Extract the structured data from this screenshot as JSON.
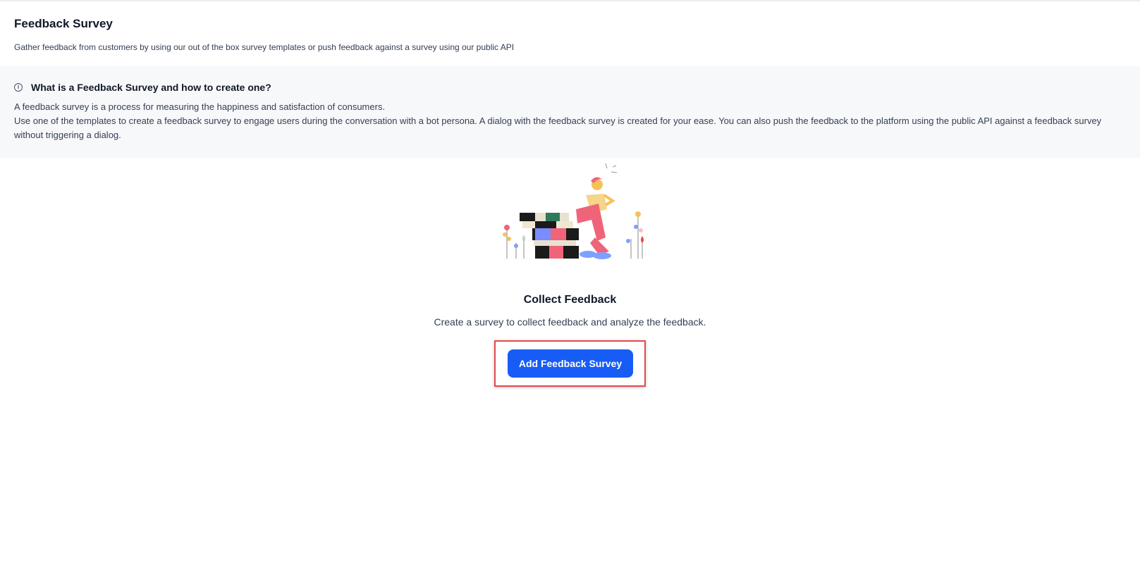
{
  "header": {
    "title": "Feedback Survey",
    "subtitle": "Gather feedback from customers by using our out of the box survey templates or push feedback against a survey using our public API"
  },
  "info": {
    "icon": "info-icon",
    "title": "What is a Feedback Survey and how to create one?",
    "line1": "A feedback survey is a process for measuring the happiness and satisfaction of consumers.",
    "line2": "Use one of the templates to create a feedback survey to engage users during the conversation with a bot persona. A dialog with the feedback survey is created for your ease. You can also push the feedback to the platform using the public API against a feedback survey without triggering a dialog."
  },
  "empty_state": {
    "illustration": "person-sitting-on-books-illustration",
    "title": "Collect Feedback",
    "description": "Create a survey to collect feedback and analyze the feedback.",
    "button_label": "Add Feedback Survey"
  },
  "colors": {
    "accent": "#175cf5",
    "highlight": "#e5484d",
    "panel_bg": "#f7f8fa"
  }
}
